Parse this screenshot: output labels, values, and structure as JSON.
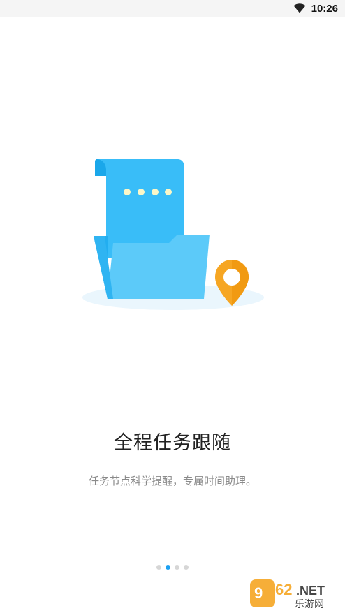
{
  "status_bar": {
    "time": "10:26",
    "wifi_icon": "wifi-icon"
  },
  "onboarding": {
    "title": "全程任务跟随",
    "description": "任务节点科学提醒，专属时间助理。",
    "illustration_icons": [
      "document-icon",
      "folder-icon",
      "location-pin-icon"
    ],
    "colors": {
      "document": "#39bdf8",
      "folder": "#5ccaf9",
      "pin": "#f6a623",
      "active_dot": "#1da1f2",
      "inactive_dot": "#d6d6d6"
    }
  },
  "pagination": {
    "total": 4,
    "active_index": 1
  },
  "watermark": {
    "logo_text": "962.NET",
    "sub_text": "乐游网"
  }
}
